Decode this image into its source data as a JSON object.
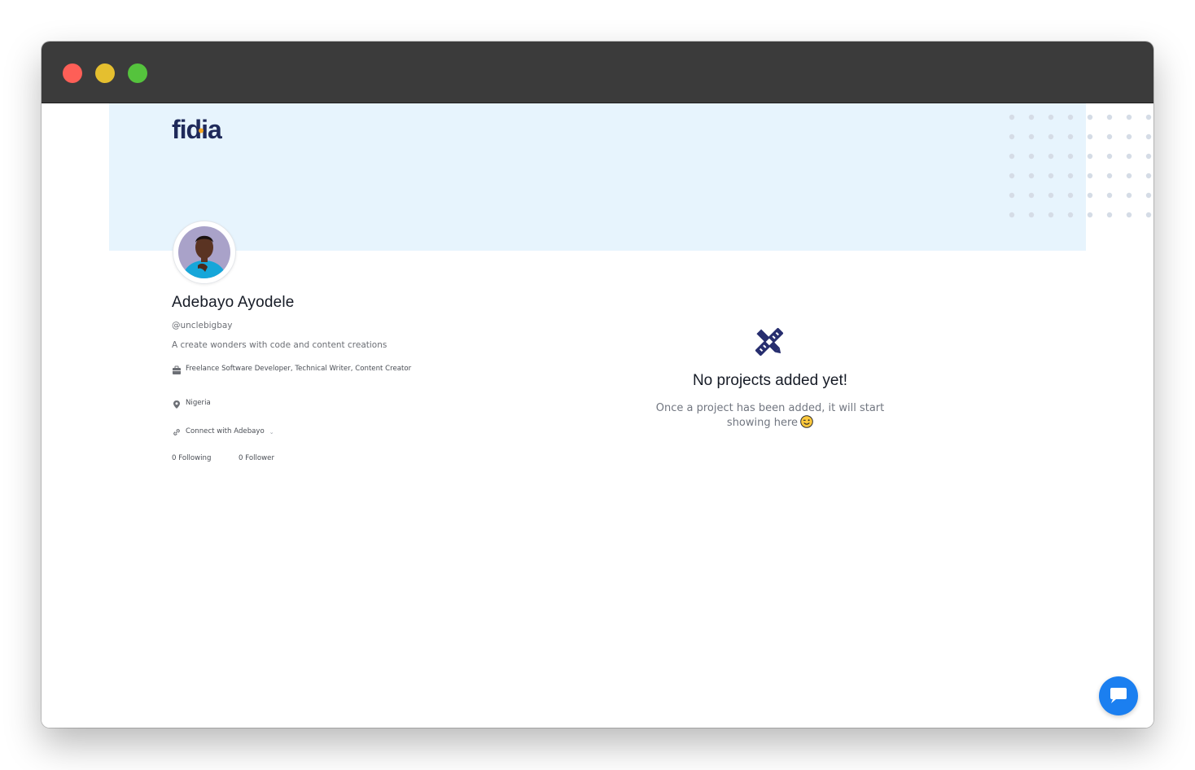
{
  "brand": {
    "logo_text": "fidia",
    "color": "#1f2a5a",
    "accent": "#f5a623"
  },
  "colors": {
    "banner": "#e7f4fd",
    "chat_button": "#1b7ff0"
  },
  "profile": {
    "name": "Adebayo Ayodele",
    "username": "@unclebigbay",
    "bio": "A create wonders with code and content creations",
    "occupation": "Freelance Software Developer, Technical Writer, Content Creator",
    "location": "Nigeria",
    "connect_label": "Connect with Adebayo",
    "following": "0 Following",
    "followers": "0 Follower"
  },
  "projects": {
    "empty_title": "No projects added yet!",
    "empty_message": "Once a project has been added, it will start showing here"
  },
  "icons": {
    "briefcase": "briefcase-icon",
    "location": "location-pin-icon",
    "link": "link-icon",
    "empty": "pencil-ruler-icon",
    "chat": "chat-icon"
  }
}
